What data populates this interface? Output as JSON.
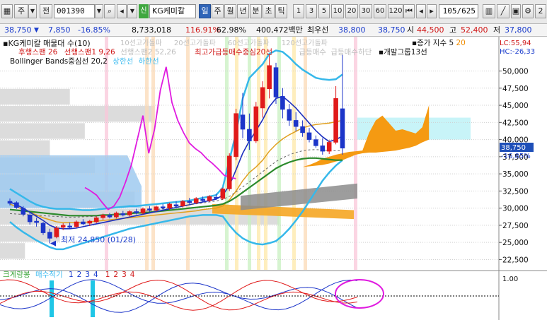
{
  "toolbar": {
    "period_label": "주",
    "prev_label": "전",
    "stock_code": "001390",
    "stock_name": "KG케미칼",
    "indicator_tag": "신",
    "tabs": [
      "일",
      "주",
      "월",
      "년",
      "분",
      "초",
      "틱"
    ],
    "active_tab": "일",
    "minute_options": [
      "1",
      "3",
      "5",
      "10",
      "20",
      "30",
      "60",
      "120"
    ],
    "page_display": "105/625",
    "right_icons": [
      "chart-type-icon",
      "draw-tool-icon",
      "save-icon",
      "settings-icon"
    ],
    "right_edge": "2"
  },
  "quote": {
    "price": "38,750",
    "change": "7,850",
    "change_pct": "-16.85%",
    "volume": "8,733,018",
    "volume_ratio": "116.91%",
    "turnover": "62.98%",
    "amount": "400,472백만",
    "side_label": "최우선",
    "ask": "38,800",
    "bid": "38,750",
    "open_label": "시",
    "open": "44,500",
    "high_label": "고",
    "high": "52,400",
    "low_label": "저",
    "low": "37,800"
  },
  "legend": {
    "title": "KG케미칼 매물대 수(10)",
    "ma_labels": [
      "10선고가돌파",
      "20선고가돌파",
      "60선고가돌파",
      "120선고가돌파"
    ],
    "ichimoku": [
      "후행스팬 26",
      "선행스팬1 9,26",
      "선행스팬2 52,26"
    ],
    "bb_label": "Bollinger Bands중심선 20,2",
    "bb_upper": "상한선",
    "bb_lower": "하한선",
    "signals": [
      "최고가",
      "급등매수중심",
      "20선",
      "급등매수",
      "급등매수하단"
    ],
    "right_legend_1": "증가 지수 5",
    "right_legend_1_val": "20",
    "right_legend_2": "개발그룹13선",
    "lc": "LC:55,94",
    "hc": "HC:-26,33",
    "low_note": "최저 24,850 (01/28)",
    "current_price_tag": "38,750",
    "current_pct_tag": "-16.85%"
  },
  "sub_legend": {
    "title": "크게랑봉",
    "signal": "매수적기",
    "nums_blue": [
      "1",
      "2",
      "3",
      "4"
    ],
    "nums_red": [
      "1",
      "2",
      "3",
      "4"
    ],
    "axis_top": "1.00"
  },
  "chart_data": {
    "type": "candlestick",
    "ylim": [
      21000,
      55000
    ],
    "yticks": [
      22500,
      25000,
      27500,
      30000,
      32500,
      35000,
      37500,
      40000,
      42500,
      45000,
      47500,
      50000
    ],
    "ytick_labels": [
      "22,500",
      "25,000",
      "27,500",
      "30,000",
      "32,500",
      "35,000",
      "37,500",
      "40,000",
      "42,500",
      "45,000",
      "47,500",
      "50,000"
    ],
    "candles": [
      [
        31000,
        31400,
        30400,
        30700
      ],
      [
        30800,
        31000,
        29900,
        30100
      ],
      [
        30000,
        30300,
        28800,
        29100
      ],
      [
        29000,
        29400,
        27600,
        28000
      ],
      [
        28100,
        28600,
        27300,
        27900
      ],
      [
        27800,
        28000,
        26100,
        26400
      ],
      [
        26500,
        27000,
        24850,
        25600
      ],
      [
        25800,
        27400,
        25600,
        27100
      ],
      [
        27200,
        27800,
        26800,
        27500
      ],
      [
        27400,
        27900,
        27000,
        27200
      ],
      [
        27300,
        28200,
        27100,
        28000
      ],
      [
        28000,
        28400,
        27500,
        27700
      ],
      [
        27800,
        28300,
        27400,
        28100
      ],
      [
        28000,
        28800,
        27800,
        28600
      ],
      [
        28600,
        29200,
        28300,
        29000
      ],
      [
        29000,
        29300,
        28500,
        28700
      ],
      [
        28700,
        29500,
        28500,
        29300
      ],
      [
        29200,
        29600,
        28800,
        29000
      ],
      [
        29000,
        29700,
        28800,
        29500
      ],
      [
        29500,
        29900,
        29100,
        29300
      ],
      [
        29300,
        30100,
        29100,
        29900
      ],
      [
        29900,
        30300,
        29500,
        29700
      ],
      [
        29700,
        30400,
        29500,
        30200
      ],
      [
        30200,
        30600,
        29800,
        30000
      ],
      [
        30000,
        30800,
        29800,
        30600
      ],
      [
        30500,
        31000,
        30100,
        30300
      ],
      [
        30300,
        31200,
        30100,
        31000
      ],
      [
        31000,
        31500,
        30600,
        30800
      ],
      [
        30800,
        31600,
        30600,
        31400
      ],
      [
        31300,
        31700,
        30900,
        31100
      ],
      [
        31100,
        31900,
        30900,
        31700
      ],
      [
        31600,
        32100,
        31200,
        31400
      ],
      [
        31400,
        33000,
        31200,
        32800
      ],
      [
        32800,
        38000,
        32500,
        37600
      ],
      [
        37500,
        44500,
        37000,
        43800
      ],
      [
        43600,
        46800,
        40200,
        41500
      ],
      [
        41500,
        43800,
        38500,
        39800
      ],
      [
        39800,
        45500,
        39500,
        44800
      ],
      [
        44600,
        48500,
        43200,
        47600
      ],
      [
        47400,
        52400,
        46000,
        50800
      ],
      [
        50500,
        51200,
        45200,
        46200
      ],
      [
        46300,
        47500,
        43100,
        44400
      ],
      [
        44400,
        45200,
        42000,
        42800
      ],
      [
        42800,
        44000,
        41200,
        41900
      ],
      [
        41900,
        42800,
        40400,
        41000
      ],
      [
        41000,
        41700,
        39600,
        40000
      ],
      [
        40000,
        40600,
        38800,
        39100
      ],
      [
        39100,
        40200,
        37800,
        38300
      ],
      [
        38300,
        39900,
        37900,
        39600
      ],
      [
        39600,
        47800,
        39300,
        46000
      ],
      [
        44500,
        52400,
        37800,
        38750
      ]
    ],
    "bb_upper": [
      32800,
      32200,
      31600,
      31000,
      30500,
      30200,
      30000,
      29900,
      29900,
      29900,
      29800,
      29700,
      29700,
      29800,
      29900,
      30000,
      30100,
      30200,
      30300,
      30300,
      30400,
      30500,
      30600,
      30700,
      30800,
      30900,
      31000,
      31100,
      31300,
      31500,
      31700,
      31900,
      33000,
      37000,
      41000,
      46000,
      49000,
      50000,
      51000,
      52500,
      53000,
      52800,
      52000,
      51000,
      50200,
      49600,
      49000,
      48800,
      48700,
      48800,
      49500
    ],
    "bb_lower": [
      28000,
      27200,
      26500,
      25900,
      25300,
      24800,
      24300,
      24000,
      24000,
      24300,
      24600,
      24900,
      25200,
      25500,
      25800,
      26100,
      26400,
      26700,
      27000,
      27200,
      27400,
      27600,
      27800,
      28000,
      28200,
      28400,
      28600,
      28800,
      28900,
      29000,
      29000,
      29000,
      28800,
      27500,
      26400,
      25600,
      25100,
      24800,
      24700,
      24900,
      25200,
      26000,
      27000,
      28200,
      29500,
      31000,
      32500,
      34000,
      35200,
      36200,
      37000
    ],
    "bb_mid": [
      30600,
      30200,
      29800,
      29400,
      29000,
      28600,
      28300,
      28000,
      27900,
      27900,
      27900,
      27900,
      28000,
      28100,
      28200,
      28300,
      28400,
      28500,
      28600,
      28700,
      28800,
      28900,
      29000,
      29100,
      29200,
      29300,
      29400,
      29500,
      29600,
      29800,
      29900,
      30000,
      30300,
      31200,
      32500,
      34000,
      35200,
      36000,
      37000,
      38300,
      39300,
      40100,
      40700,
      41200,
      41700,
      42000,
      42200,
      42300,
      42400,
      42600,
      42800
    ],
    "ma_short": [
      30900,
      30500,
      30000,
      29400,
      28800,
      28200,
      27500,
      27100,
      27000,
      27000,
      27100,
      27300,
      27500,
      27700,
      27900,
      28100,
      28300,
      28500,
      28700,
      28900,
      29100,
      29300,
      29500,
      29700,
      29900,
      30100,
      30300,
      30500,
      30700,
      30900,
      31100,
      31300,
      31900,
      33300,
      35600,
      38000,
      39800,
      41300,
      42900,
      44800,
      46000,
      46300,
      45500,
      44600,
      43500,
      42400,
      41300,
      40400,
      39700,
      40000,
      40500
    ],
    "ma_long": [
      29800,
      29700,
      29600,
      29500,
      29400,
      29300,
      29200,
      29100,
      29000,
      28900,
      28900,
      28900,
      28900,
      28900,
      29000,
      29000,
      29100,
      29100,
      29200,
      29300,
      29300,
      29400,
      29500,
      29600,
      29700,
      29800,
      29900,
      30000,
      30100,
      30200,
      30300,
      30400,
      30600,
      31000,
      31600,
      32300,
      33000,
      33700,
      34400,
      35100,
      35800,
      36300,
      36700,
      37000,
      37200,
      37300,
      37300,
      37200,
      37100,
      37000,
      37000
    ],
    "ichimoku_x": [
      44,
      45,
      46,
      47,
      48,
      49,
      50,
      51,
      52,
      53,
      54,
      55,
      56,
      57,
      58,
      59,
      60,
      61,
      62,
      63
    ],
    "ichimoku_top": [
      36000,
      36300,
      36700,
      37200,
      37500,
      37800,
      38000,
      38200,
      38300,
      38400,
      41000,
      42800,
      43500,
      42400,
      41300,
      41500,
      41200,
      40900,
      41800,
      45000
    ],
    "ichimoku_bot": [
      36000,
      36100,
      36200,
      36300,
      36500,
      36800,
      37000,
      37400,
      37800,
      38000,
      38100,
      38100,
      38200,
      38300,
      38400,
      38600,
      38800,
      39100,
      39600,
      40000
    ],
    "volume_profile": [
      [
        22500,
        25000,
        0.05
      ],
      [
        25000,
        27500,
        0.12
      ],
      [
        27500,
        30000,
        0.56
      ],
      [
        30000,
        32500,
        0.27
      ],
      [
        32500,
        35000,
        0.09
      ],
      [
        35000,
        37500,
        0.19
      ],
      [
        37500,
        40000,
        0.1
      ],
      [
        40000,
        42500,
        0.17
      ],
      [
        42500,
        45000,
        0.31
      ],
      [
        45000,
        47500,
        0.14
      ]
    ]
  }
}
